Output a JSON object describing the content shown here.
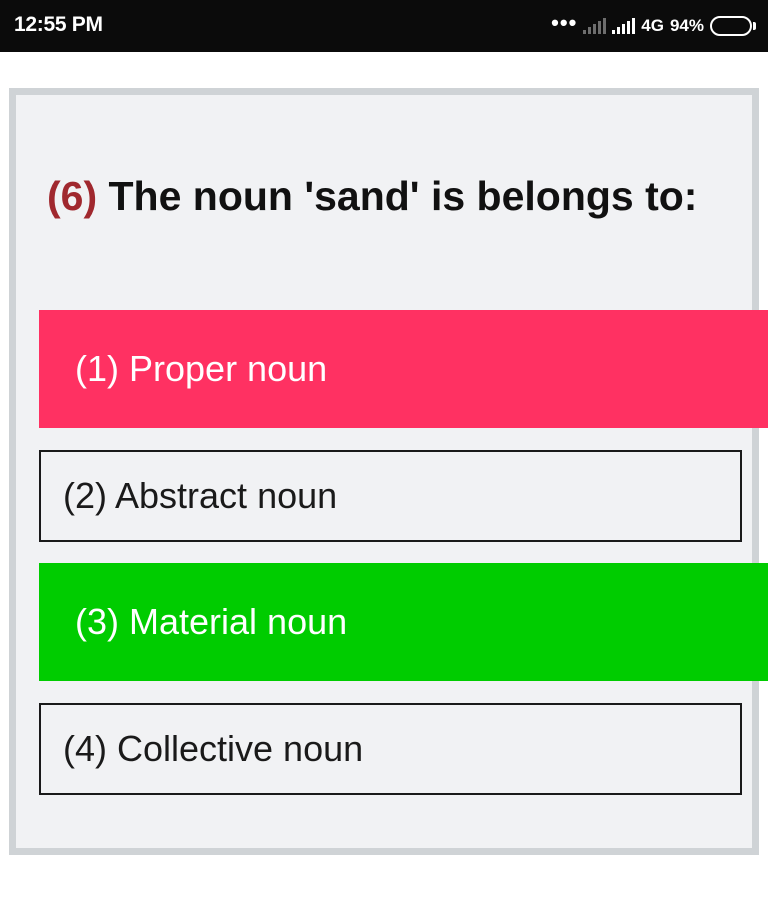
{
  "status_bar": {
    "time": "12:55 PM",
    "network": "4G",
    "battery": "94%",
    "battery_level": 0.94
  },
  "quiz": {
    "question_number": "(6)",
    "question_text": "The noun 'sand' is belongs to:",
    "options": [
      {
        "label": "(1) Proper noun",
        "state": "incorrect",
        "color": "#ff3162"
      },
      {
        "label": "(2) Abstract noun",
        "state": "default",
        "color": "#1a1a1a"
      },
      {
        "label": "(3) Material noun",
        "state": "correct",
        "color": "#00cc00"
      },
      {
        "label": "(4) Collective noun",
        "state": "default",
        "color": "#1a1a1a"
      }
    ],
    "question_number_color": "#a0282e",
    "card_background": "#f1f2f4",
    "card_border": "#cfd3d6"
  }
}
